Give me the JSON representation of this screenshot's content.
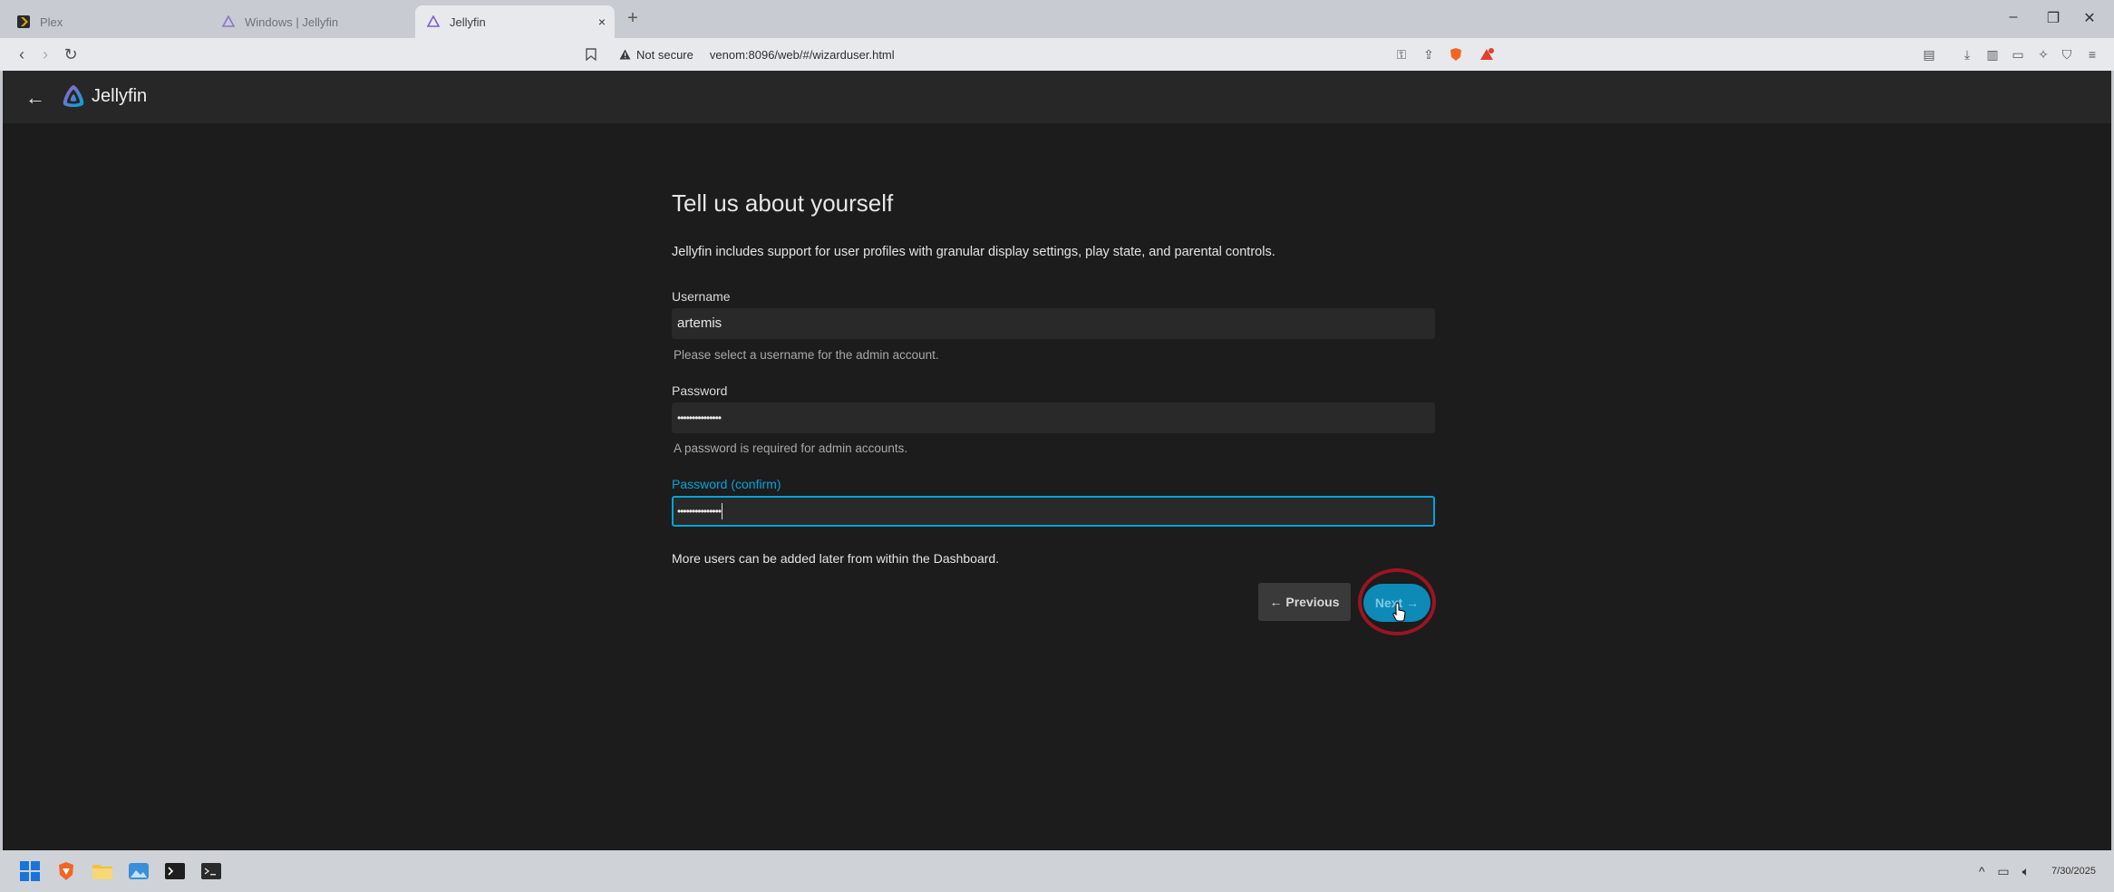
{
  "browser": {
    "tabs": [
      {
        "title": "Plex",
        "icon": "plex-icon",
        "active": false
      },
      {
        "title": "Windows | Jellyfin",
        "icon": "jellyfin-icon",
        "active": false
      },
      {
        "title": "Jellyfin",
        "icon": "jellyfin-icon",
        "active": true,
        "close": "×"
      }
    ],
    "new_tab": "+",
    "window_controls": {
      "minimize": "–",
      "restore": "❐",
      "close": "✕"
    },
    "nav": {
      "back": "‹",
      "forward": "›",
      "reload": "↻"
    },
    "address": {
      "security_label": "Not secure",
      "url": "venom:8096/web/#/wizarduser.html"
    }
  },
  "app": {
    "brand": "Jellyfin",
    "back_label": "←"
  },
  "wizard": {
    "title": "Tell us about yourself",
    "intro": "Jellyfin includes support for user profiles with granular display settings, play state, and parental controls.",
    "username": {
      "label": "Username",
      "value": "artemis",
      "helper": "Please select a username for the admin account."
    },
    "password": {
      "label": "Password",
      "value": "•••••••••••••••",
      "helper": "A password is required for admin accounts."
    },
    "password_confirm": {
      "label": "Password (confirm)",
      "value": "•••••••••••••••"
    },
    "more_users": "More users can be added later from within the Dashboard.",
    "previous_label": "← Previous",
    "next_label": "Next →"
  },
  "taskbar": {
    "apps": [
      "windows-start-icon",
      "brave-browser-icon",
      "file-explorer-icon",
      "photos-icon",
      "terminal-icon",
      "command-prompt-icon"
    ],
    "clock_date": "7/30/2025"
  },
  "colors": {
    "accent": "#00a4dc",
    "next_button": "#0e8ab7",
    "highlight_ring": "#9b1423",
    "page_bg": "#1c1c1c",
    "header_bg": "#272727"
  }
}
